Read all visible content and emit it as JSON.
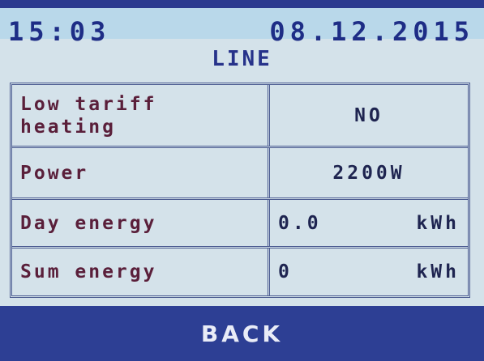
{
  "header": {
    "time": "15:03",
    "date": "08.12.2015"
  },
  "title": "LINE",
  "rows": [
    {
      "label": "Low tariff\nheating",
      "value": "NO"
    },
    {
      "label": "Power",
      "value": "2200W"
    },
    {
      "label": "Day energy",
      "value": "0.0",
      "unit": "kWh"
    },
    {
      "label": "Sum energy",
      "value": "0",
      "unit": "kWh"
    }
  ],
  "footer": {
    "back_label": "BACK"
  },
  "colors": {
    "status_bar": "#b9d8ea",
    "screen_bg": "#d4e2ea",
    "footer_bg": "#2d3f94",
    "label_text": "#5a1f3a",
    "value_text": "#1e2450"
  }
}
